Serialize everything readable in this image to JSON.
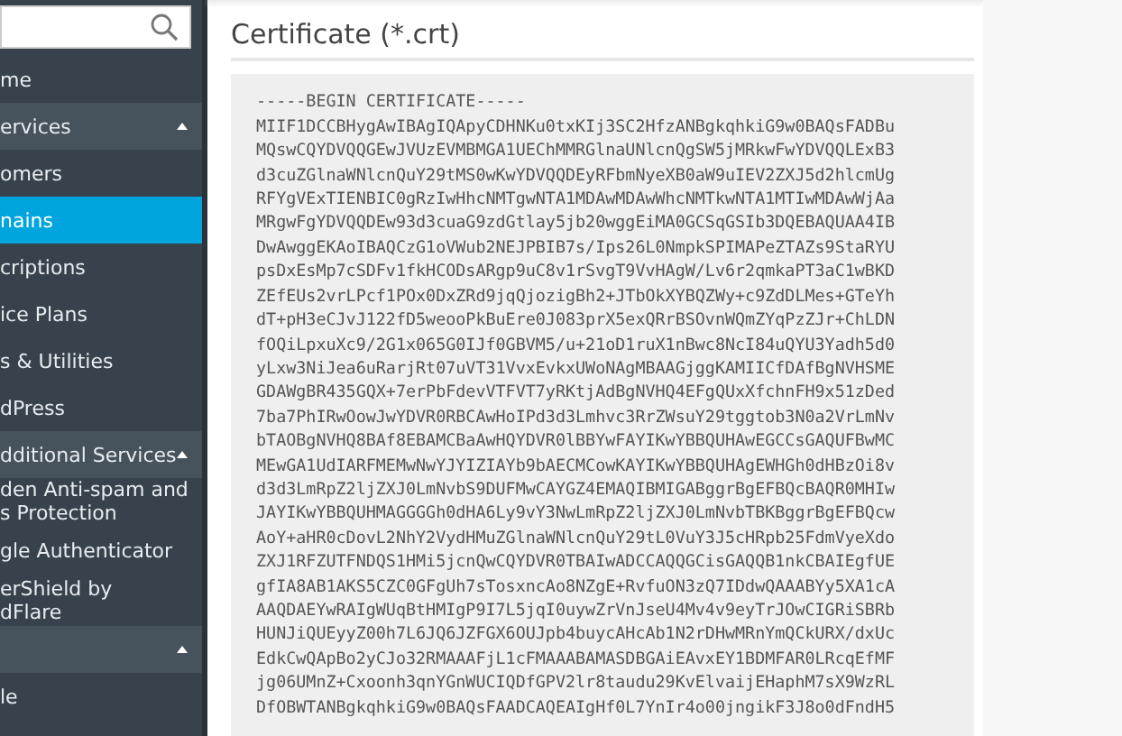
{
  "sidebar": {
    "items": [
      {
        "kind": "item",
        "label": "me",
        "selected": false
      },
      {
        "kind": "header",
        "label": "ervices",
        "expanded": true
      },
      {
        "kind": "item",
        "label": "omers",
        "selected": false
      },
      {
        "kind": "item",
        "label": "nains",
        "selected": true
      },
      {
        "kind": "item",
        "label": "criptions",
        "selected": false
      },
      {
        "kind": "item",
        "label": "ice Plans",
        "selected": false
      },
      {
        "kind": "item",
        "label": "s & Utilities",
        "selected": false
      },
      {
        "kind": "item",
        "label": "dPress",
        "selected": false
      },
      {
        "kind": "header",
        "label": "dditional Services",
        "expanded": true
      },
      {
        "kind": "item",
        "lines": [
          "den Anti-spam and",
          "s Protection"
        ],
        "selected": false
      },
      {
        "kind": "item",
        "label": "gle Authenticator",
        "selected": false
      },
      {
        "kind": "item",
        "lines": [
          "erShield by",
          "dFlare"
        ],
        "selected": false
      },
      {
        "kind": "header",
        "expanded": true
      },
      {
        "kind": "item",
        "label": "le",
        "selected": false
      }
    ]
  },
  "certificate": {
    "title": "Certificate (*.crt)",
    "lines": [
      "-----BEGIN CERTIFICATE-----",
      "MIIF1DCCBHygAwIBAgIQApyCDHNKu0txKIj3SC2HfzANBgkqhkiG9w0BAQsFADBu",
      "MQswCQYDVQQGEwJVUzEVMBMGA1UEChMMRGlnaUNlcnQgSW5jMRkwFwYDVQQLExB3",
      "d3cuZGlnaWNlcnQuY29tMS0wKwYDVQQDEyRFbmNyeXB0aW9uIEV2ZXJ5d2hlcmUg",
      "RFYgVExTIENBIC0gRzIwHhcNMTgwNTA1MDAwMDAwWhcNMTkwNTA1MTIwMDAwWjAa",
      "MRgwFgYDVQQDEw93d3cuaG9zdGtlay5jb20wggEiMA0GCSqGSIb3DQEBAQUAA4IB",
      "DwAwggEKAoIBAQCzG1oVWub2NEJPBIB7s/Ips26L0NmpkSPIMAPeZTAZs9StaRYU",
      "psDxEsMp7cSDFv1fkHCODsARgp9uC8v1rSvgT9VvHAgW/Lv6r2qmkaPT3aC1wBKD",
      "ZEfEUs2vrLPcf1POx0DxZRd9jqQjozigBh2+JTbOkXYBQZWy+c9ZdDLMes+GTeYh",
      "dT+pH3eCJvJ122fD5weooPkBuEre0J083prX5exQRrBSOvnWQmZYqPzZJr+ChLDN",
      "fOQiLpxuXc9/2G1x065G0IJf0GBVM5/u+21oD1ruX1nBwc8NcI84uQYU3Yadh5d0",
      "yLxw3NiJea6uRarjRt07uVT31VvxEvkxUWoNAgMBAAGjggKAMIICfDAfBgNVHSME",
      "GDAWgBR435GQX+7erPbFdevVTFVT7yRKtjAdBgNVHQ4EFgQUxXfchnFH9x51zDed",
      "7ba7PhIRwOowJwYDVR0RBCAwHoIPd3d3Lmhvc3RrZWsuY29tggtob3N0a2VrLmNv",
      "bTAOBgNVHQ8BAf8EBAMCBaAwHQYDVR0lBBYwFAYIKwYBBQUHAwEGCCsGAQUFBwMC",
      "MEwGA1UdIARFMEMwNwYJYIZIAYb9bAECMCowKAYIKwYBBQUHAgEWHGh0dHBzOi8v",
      "d3d3LmRpZ2ljZXJ0LmNvbS9DUFMwCAYGZ4EMAQIBMIGABggrBgEFBQcBAQR0MHIw",
      "JAYIKwYBBQUHMAGGGGh0dHA6Ly9vY3NwLmRpZ2ljZXJ0LmNvbTBKBggrBgEFBQcw",
      "AoY+aHR0cDovL2NhY2VydHMuZGlnaWNlcnQuY29tL0VuY3J5cHRpb25FdmVyeXdo",
      "ZXJ1RFZUTFNDQS1HMi5jcnQwCQYDVR0TBAIwADCCAQQGCisGAQQB1nkCBAIEgfUE",
      "gfIA8AB1AKS5CZC0GFgUh7sTosxncAo8NZgE+RvfuON3zQ7IDdwQAAABYy5XA1cA",
      "AAQDAEYwRAIgWUqBtHMIgP9I7L5jqI0uywZrVnJseU4Mv4v9eyTrJOwCIGRiSBRb",
      "HUNJiQUEyyZ00h7L6JQ6JZFGX6OUJpb4buycAHcAb1N2rDHwMRnYmQCkURX/dxUc",
      "EdkCwQApBo2yCJo32RMAAAFjL1cFMAAABAMASDBGAiEAvxEY1BDMFAR0LRcqEfMF",
      "jg06UMnZ+Cxoonh3qnYGnWUCIQDfGPV2lr8taudu29KvElvaijEHaphM7sX9WzRL",
      "DfOBWTANBgkqhkiG9w0BAQsFAADCAQEAIgHf0L7YnIr4o00jngikF3J8o0dFndH5"
    ]
  }
}
